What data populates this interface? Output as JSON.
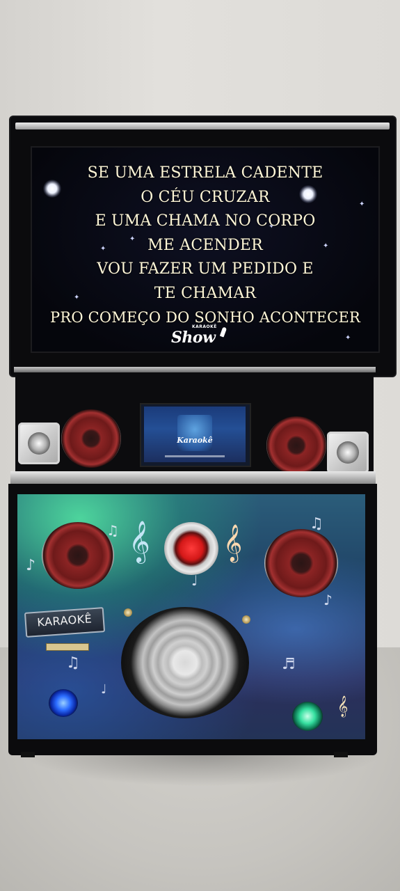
{
  "lyrics": {
    "lines": [
      "SE UMA ESTRELA CADENTE",
      "O CÉU CRUZAR",
      "E UMA CHAMA NO CORPO",
      "ME ACENDER",
      "VOU FAZER UM PEDIDO E",
      "TE CHAMAR",
      "PRO COMEÇO DO SONHO ACONTECER"
    ]
  },
  "screen_logo": {
    "small": "KARAOKÊ",
    "script": "Show"
  },
  "tablet": {
    "title": "Karaokê"
  },
  "panel": {
    "sign": "KARAOKÊ"
  },
  "colors": {
    "lyric": "#fff7d8",
    "accent_red": "#c62828",
    "led_blue": "#2b6cff",
    "led_green": "#36e0a0"
  }
}
